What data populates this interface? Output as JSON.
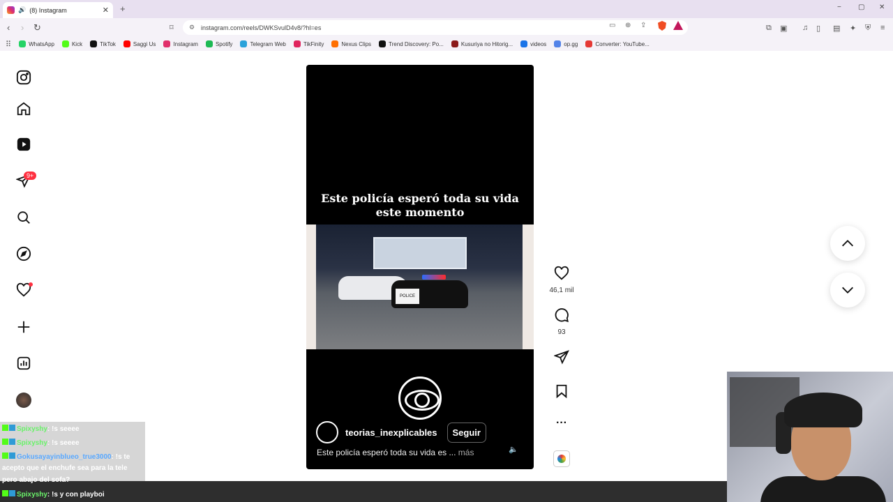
{
  "browser": {
    "tab_title": "(8) Instagram",
    "new_tab": "+",
    "url": "instagram.com/reels/DWKSvulD4v8/?hl=es",
    "window_controls": [
      "−",
      "▢",
      "✕"
    ]
  },
  "bookmarks": [
    {
      "label": "WhatsApp",
      "color": "#25d366"
    },
    {
      "label": "Kick",
      "color": "#53fc18"
    },
    {
      "label": "TikTok",
      "color": "#111111"
    },
    {
      "label": "Saggi Us",
      "color": "#ff0000"
    },
    {
      "label": "Instagram",
      "color": "#e1306c"
    },
    {
      "label": "Spotify",
      "color": "#1db954"
    },
    {
      "label": "Telegram Web",
      "color": "#2aa1da"
    },
    {
      "label": "TikFinity",
      "color": "#e0245e"
    },
    {
      "label": "Nexus Clips",
      "color": "#ff6f00"
    },
    {
      "label": "Trend Discovery: Po...",
      "color": "#111111"
    },
    {
      "label": "Kusuriya no Hitorig...",
      "color": "#8b1a1a"
    },
    {
      "label": "videos",
      "color": "#1a73e8"
    },
    {
      "label": "op.gg",
      "color": "#5383e8"
    },
    {
      "label": "Converter: YouTube...",
      "color": "#e53935"
    }
  ],
  "nav": {
    "badge": "9+"
  },
  "reel": {
    "overlay_title_line1": "Este policía esperó toda su vida",
    "overlay_title_line2": "este momento",
    "police_text": "POLICE",
    "author": "teorias_inexplicables",
    "follow": "Seguir",
    "description": "Este policía esperó toda su vida es ...",
    "more": "más"
  },
  "actions": {
    "likes": "46,1 mil",
    "comments": "93"
  },
  "chat": [
    {
      "user": "Spixyshy",
      "text": ": !s seeee",
      "color": "green"
    },
    {
      "user": "Spixyshy",
      "text": ": !s seeee",
      "color": "green"
    },
    {
      "user": "Gokusayayinblueo_true3000",
      "text": ": !s te",
      "color": "blue"
    },
    {
      "user": "",
      "text": "acepto que el enchufe sea para la tele",
      "color": "none"
    },
    {
      "user": "",
      "text": "pero abajo del sofa?",
      "color": "none"
    },
    {
      "user": "Spixyshy",
      "text": ": !s y con playboi",
      "color": "green"
    }
  ]
}
